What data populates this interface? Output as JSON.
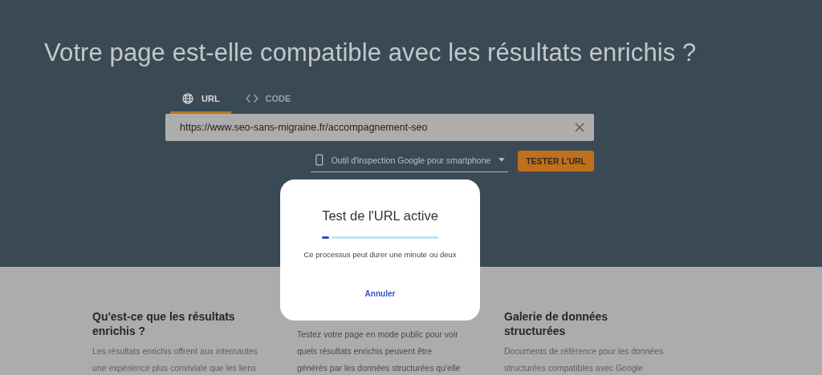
{
  "page_title": "Votre page est-elle compatible avec les résultats enrichis ?",
  "tabs": [
    {
      "label": "URL",
      "kind": "globe",
      "selected": true
    },
    {
      "label": "CODE",
      "kind": "code",
      "selected": false
    }
  ],
  "url_field": {
    "value": "https://www.seo-sans-migraine.fr/accompagnement-seo"
  },
  "agent_select": {
    "value": "Outil d'inspection Google pour smartphone"
  },
  "test_button": "TESTER L'URL",
  "sections": [
    {
      "title": "Qu'est-ce que les résultats enrichis ?",
      "lines": [
        "Les résultats enrichis offrent aux internautes",
        "une expérience plus conviviale que les liens"
      ]
    },
    {
      "lines": [
        "Testez votre page en mode public pour voir",
        "quels résultats enrichis peuvent être",
        "générés par les données structurées qu'elle"
      ]
    },
    {
      "title": "Galerie de données structurées",
      "lines": [
        "Documents de référence pour les données",
        "structurées compatibles avec Google"
      ]
    }
  ],
  "dialog": {
    "title": "Test de l'URL active",
    "progress": {
      "level": 0.06
    },
    "message": "Ce processus peut durer une minute ou deux",
    "cancel": "Annuler"
  }
}
